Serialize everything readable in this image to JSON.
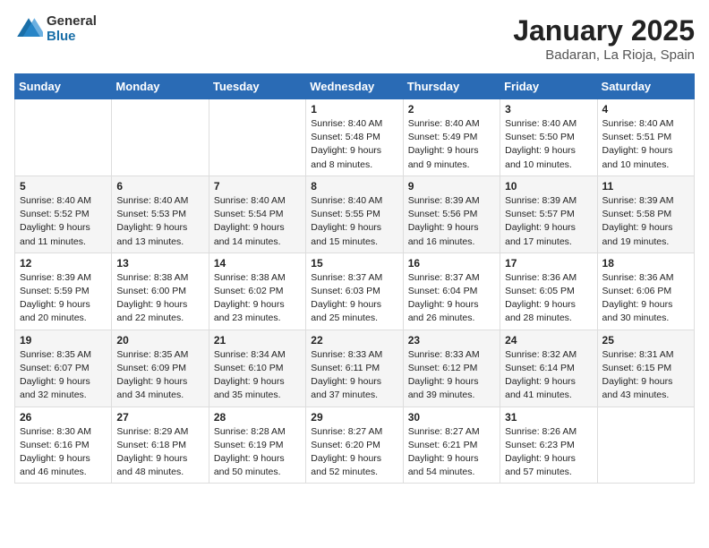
{
  "header": {
    "logo_general": "General",
    "logo_blue": "Blue",
    "title": "January 2025",
    "location": "Badaran, La Rioja, Spain"
  },
  "weekdays": [
    "Sunday",
    "Monday",
    "Tuesday",
    "Wednesday",
    "Thursday",
    "Friday",
    "Saturday"
  ],
  "weeks": [
    [
      {
        "day": "",
        "info": ""
      },
      {
        "day": "",
        "info": ""
      },
      {
        "day": "",
        "info": ""
      },
      {
        "day": "1",
        "info": "Sunrise: 8:40 AM\nSunset: 5:48 PM\nDaylight: 9 hours\nand 8 minutes."
      },
      {
        "day": "2",
        "info": "Sunrise: 8:40 AM\nSunset: 5:49 PM\nDaylight: 9 hours\nand 9 minutes."
      },
      {
        "day": "3",
        "info": "Sunrise: 8:40 AM\nSunset: 5:50 PM\nDaylight: 9 hours\nand 10 minutes."
      },
      {
        "day": "4",
        "info": "Sunrise: 8:40 AM\nSunset: 5:51 PM\nDaylight: 9 hours\nand 10 minutes."
      }
    ],
    [
      {
        "day": "5",
        "info": "Sunrise: 8:40 AM\nSunset: 5:52 PM\nDaylight: 9 hours\nand 11 minutes."
      },
      {
        "day": "6",
        "info": "Sunrise: 8:40 AM\nSunset: 5:53 PM\nDaylight: 9 hours\nand 13 minutes."
      },
      {
        "day": "7",
        "info": "Sunrise: 8:40 AM\nSunset: 5:54 PM\nDaylight: 9 hours\nand 14 minutes."
      },
      {
        "day": "8",
        "info": "Sunrise: 8:40 AM\nSunset: 5:55 PM\nDaylight: 9 hours\nand 15 minutes."
      },
      {
        "day": "9",
        "info": "Sunrise: 8:39 AM\nSunset: 5:56 PM\nDaylight: 9 hours\nand 16 minutes."
      },
      {
        "day": "10",
        "info": "Sunrise: 8:39 AM\nSunset: 5:57 PM\nDaylight: 9 hours\nand 17 minutes."
      },
      {
        "day": "11",
        "info": "Sunrise: 8:39 AM\nSunset: 5:58 PM\nDaylight: 9 hours\nand 19 minutes."
      }
    ],
    [
      {
        "day": "12",
        "info": "Sunrise: 8:39 AM\nSunset: 5:59 PM\nDaylight: 9 hours\nand 20 minutes."
      },
      {
        "day": "13",
        "info": "Sunrise: 8:38 AM\nSunset: 6:00 PM\nDaylight: 9 hours\nand 22 minutes."
      },
      {
        "day": "14",
        "info": "Sunrise: 8:38 AM\nSunset: 6:02 PM\nDaylight: 9 hours\nand 23 minutes."
      },
      {
        "day": "15",
        "info": "Sunrise: 8:37 AM\nSunset: 6:03 PM\nDaylight: 9 hours\nand 25 minutes."
      },
      {
        "day": "16",
        "info": "Sunrise: 8:37 AM\nSunset: 6:04 PM\nDaylight: 9 hours\nand 26 minutes."
      },
      {
        "day": "17",
        "info": "Sunrise: 8:36 AM\nSunset: 6:05 PM\nDaylight: 9 hours\nand 28 minutes."
      },
      {
        "day": "18",
        "info": "Sunrise: 8:36 AM\nSunset: 6:06 PM\nDaylight: 9 hours\nand 30 minutes."
      }
    ],
    [
      {
        "day": "19",
        "info": "Sunrise: 8:35 AM\nSunset: 6:07 PM\nDaylight: 9 hours\nand 32 minutes."
      },
      {
        "day": "20",
        "info": "Sunrise: 8:35 AM\nSunset: 6:09 PM\nDaylight: 9 hours\nand 34 minutes."
      },
      {
        "day": "21",
        "info": "Sunrise: 8:34 AM\nSunset: 6:10 PM\nDaylight: 9 hours\nand 35 minutes."
      },
      {
        "day": "22",
        "info": "Sunrise: 8:33 AM\nSunset: 6:11 PM\nDaylight: 9 hours\nand 37 minutes."
      },
      {
        "day": "23",
        "info": "Sunrise: 8:33 AM\nSunset: 6:12 PM\nDaylight: 9 hours\nand 39 minutes."
      },
      {
        "day": "24",
        "info": "Sunrise: 8:32 AM\nSunset: 6:14 PM\nDaylight: 9 hours\nand 41 minutes."
      },
      {
        "day": "25",
        "info": "Sunrise: 8:31 AM\nSunset: 6:15 PM\nDaylight: 9 hours\nand 43 minutes."
      }
    ],
    [
      {
        "day": "26",
        "info": "Sunrise: 8:30 AM\nSunset: 6:16 PM\nDaylight: 9 hours\nand 46 minutes."
      },
      {
        "day": "27",
        "info": "Sunrise: 8:29 AM\nSunset: 6:18 PM\nDaylight: 9 hours\nand 48 minutes."
      },
      {
        "day": "28",
        "info": "Sunrise: 8:28 AM\nSunset: 6:19 PM\nDaylight: 9 hours\nand 50 minutes."
      },
      {
        "day": "29",
        "info": "Sunrise: 8:27 AM\nSunset: 6:20 PM\nDaylight: 9 hours\nand 52 minutes."
      },
      {
        "day": "30",
        "info": "Sunrise: 8:27 AM\nSunset: 6:21 PM\nDaylight: 9 hours\nand 54 minutes."
      },
      {
        "day": "31",
        "info": "Sunrise: 8:26 AM\nSunset: 6:23 PM\nDaylight: 9 hours\nand 57 minutes."
      },
      {
        "day": "",
        "info": ""
      }
    ]
  ]
}
